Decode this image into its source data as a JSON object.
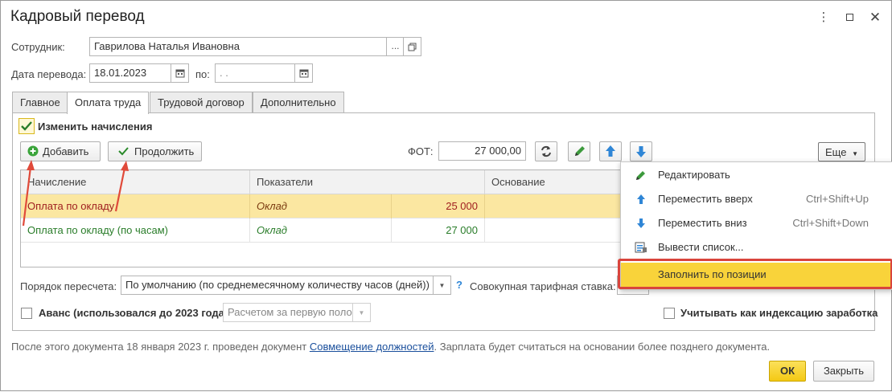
{
  "window": {
    "title": "Кадровый перевод"
  },
  "employee": {
    "label": "Сотрудник:",
    "value": "Гаврилова Наталья Ивановна",
    "select_btn": "..."
  },
  "transfer_date": {
    "label": "Дата перевода:",
    "value": "18.01.2023",
    "to_label": "по:",
    "to_value": ". ."
  },
  "tabs": [
    {
      "label": "Главное"
    },
    {
      "label": "Оплата труда"
    },
    {
      "label": "Трудовой договор"
    },
    {
      "label": "Дополнительно"
    }
  ],
  "change_accruals": {
    "label": "Изменить начисления",
    "checked": true
  },
  "toolbar": {
    "add_label": "Добавить",
    "continue_label": "Продолжить",
    "fot_label": "ФОТ:",
    "fot_value": "27 000,00",
    "more_label": "Еще"
  },
  "table": {
    "columns": [
      "Начисление",
      "Показатели",
      "Основание"
    ],
    "rows": [
      {
        "accrual": "Оплата по окладу",
        "indicator": "Оклад",
        "amount": "25 000"
      },
      {
        "accrual": "Оплата по окладу (по часам)",
        "indicator": "Оклад",
        "amount": "27 000"
      }
    ]
  },
  "context_menu": {
    "items": [
      {
        "label": "Редактировать",
        "shortcut": "",
        "icon": "pencil-icon"
      },
      {
        "label": "Переместить вверх",
        "shortcut": "Ctrl+Shift+Up",
        "icon": "arrow-up-icon"
      },
      {
        "label": "Переместить вниз",
        "shortcut": "Ctrl+Shift+Down",
        "icon": "arrow-down-icon"
      },
      {
        "label": "Вывести список...",
        "shortcut": "",
        "icon": "list-output-icon"
      },
      {
        "label": "Заполнить по позиции",
        "shortcut": "",
        "icon": ""
      }
    ]
  },
  "recalc": {
    "label": "Порядок пересчета:",
    "value": "По умолчанию (по среднемесячному количеству часов (дней))",
    "help": "?",
    "tariff_label": "Совокупная тарифная ставка:"
  },
  "advance": {
    "label": "Аванс (использовался до 2023 года)",
    "value": "Расчетом за первую поло",
    "checked": false
  },
  "indexation": {
    "label": "Учитывать как индексацию заработка",
    "checked": false
  },
  "footer_note": {
    "prefix": "После этого документа 18 января 2023 г. проведен документ",
    "link": "Совмещение должностей",
    "suffix": ". Зарплата будет считаться на основании более позднего документа."
  },
  "buttons": {
    "ok": "ОК",
    "close": "Закрыть"
  },
  "colors": {
    "selected_row": "#fbe7a1",
    "accent_yellow": "#f9d33a",
    "highlight_red": "#d9443c",
    "green_text": "#2a7d2a",
    "red_text": "#a02020",
    "arrow_red": "#e04a3a"
  }
}
